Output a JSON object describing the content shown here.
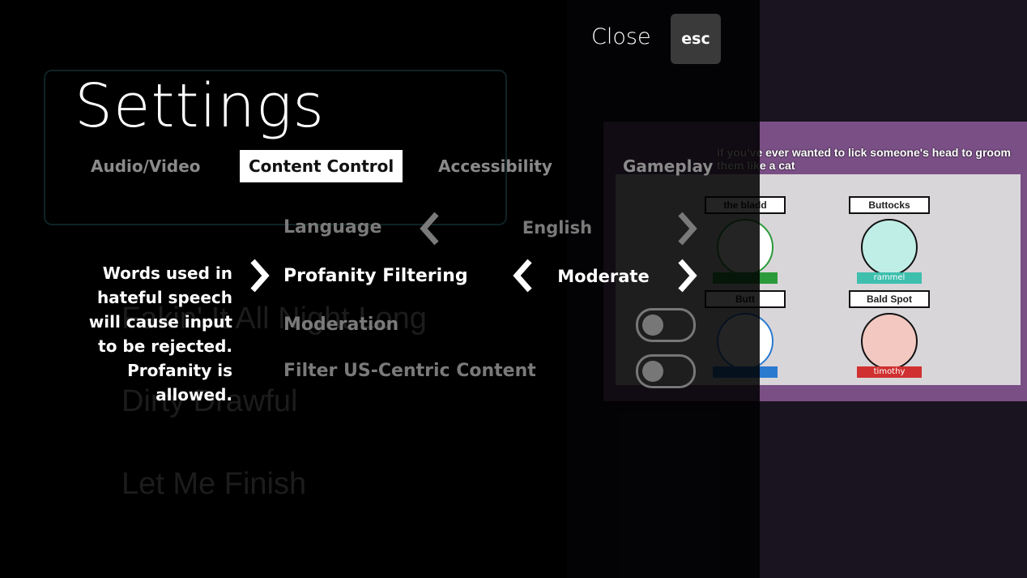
{
  "header": {
    "close_label": "Close",
    "close_key": "esc",
    "title": "Settings"
  },
  "tabs": [
    {
      "label": "Audio/Video",
      "active": false
    },
    {
      "label": "Content Control",
      "active": true
    },
    {
      "label": "Accessibility",
      "active": false
    },
    {
      "label": "Gameplay",
      "active": false
    }
  ],
  "settings": [
    {
      "label": "Language",
      "type": "selector",
      "value": "English",
      "selected": false
    },
    {
      "label": "Profanity Filtering",
      "type": "selector",
      "value": "Moderate",
      "selected": true
    },
    {
      "label": "Moderation",
      "type": "toggle",
      "on": false
    },
    {
      "label": "Filter US-Centric Content",
      "type": "toggle",
      "on": false
    }
  ],
  "description": "Words used in hateful speech will cause input to be rejected. Profanity is allowed.",
  "background": {
    "menu_items": [
      "Fakin' It All Night Long",
      "Dirty Drawful",
      "Let Me Finish"
    ],
    "prompt": "if you've ever wanted to lick someone's head to groom them like a cat",
    "cards": [
      {
        "name": "the bladd",
        "player": "",
        "color": "#2a9a3a"
      },
      {
        "name": "Buttocks",
        "player": "rammel",
        "color": "#3fbfae"
      },
      {
        "name": "Butt",
        "player": "",
        "color": "#2a7ad0"
      },
      {
        "name": "Bald Spot",
        "player": "timothy",
        "color": "#d03030"
      }
    ]
  },
  "colors": {
    "active_tab_bg": "#ffffff",
    "inactive_text": "#7a7a7a",
    "esc_bg": "#3a3a3a"
  }
}
